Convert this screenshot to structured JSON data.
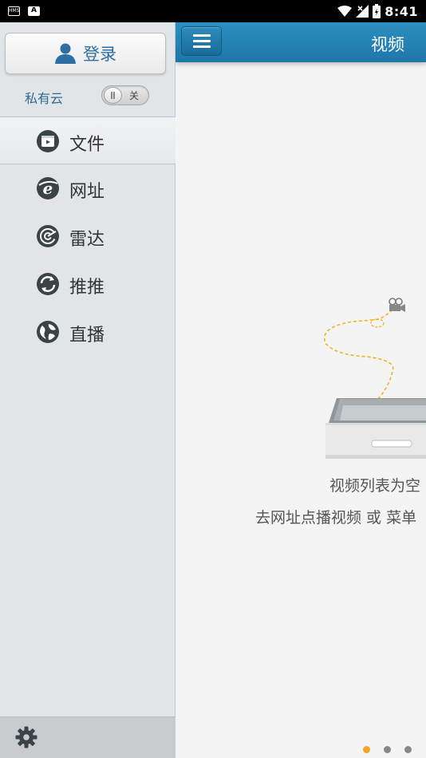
{
  "status_bar": {
    "left_icons": [
      "sim-card-icon",
      "notification-a-icon"
    ],
    "notification_letter": "A",
    "right_icons": [
      "wifi-icon",
      "no-signal-icon",
      "battery-icon"
    ],
    "time": "8:41"
  },
  "sidebar": {
    "login_label": "登录",
    "private_cloud_label": "私有云",
    "private_cloud_toggle_text": "关",
    "private_cloud_on": false,
    "nav_items": [
      {
        "label": "文件",
        "icon": "file-icon",
        "active": true
      },
      {
        "label": "网址",
        "icon": "web-icon",
        "active": false
      },
      {
        "label": "雷达",
        "icon": "radar-icon",
        "active": false
      },
      {
        "label": "推推",
        "icon": "push-icon",
        "active": false
      },
      {
        "label": "直播",
        "icon": "live-icon",
        "active": false
      }
    ],
    "settings_icon": "gear-icon"
  },
  "main": {
    "title": "视频",
    "empty_line1": "视频列表为空",
    "empty_line2": "去网址点播视频 或 菜单",
    "pager": {
      "count": 3,
      "active_index": 0
    }
  },
  "colors": {
    "topbar": "#1e76a8",
    "accent": "#2f6ea0",
    "pager_active": "#f5a623"
  }
}
